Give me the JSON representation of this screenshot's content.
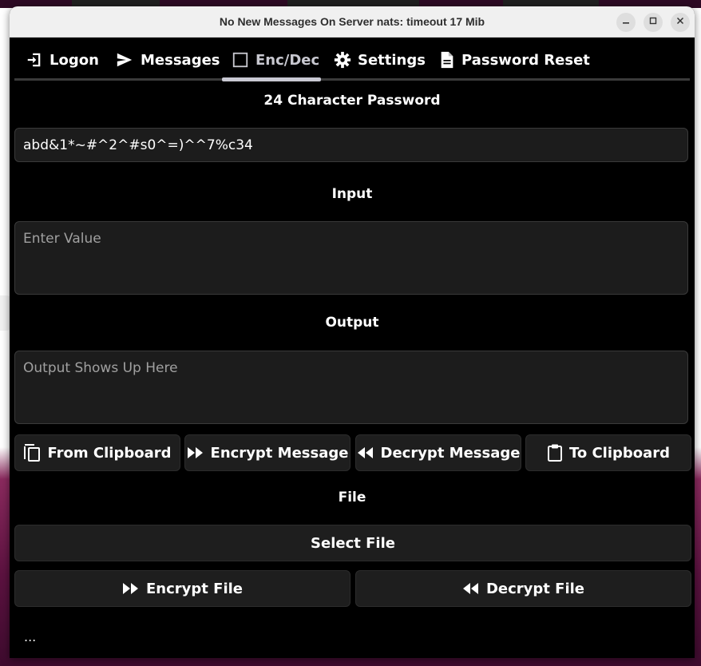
{
  "window": {
    "title": "No New Messages On Server nats: timeout 17 Mib"
  },
  "tabs": [
    {
      "label": "Logon",
      "icon": "login-icon"
    },
    {
      "label": "Messages",
      "icon": "send-icon"
    },
    {
      "label": "Enc/Dec",
      "icon": "checkbox-icon",
      "active": true
    },
    {
      "label": "Settings",
      "icon": "gear-icon"
    },
    {
      "label": "Password Reset",
      "icon": "document-icon"
    }
  ],
  "password": {
    "label": "24 Character Password",
    "value": "abd&1*~#^2^#s0^=)^^7%c34"
  },
  "input": {
    "label": "Input",
    "placeholder": "Enter Value"
  },
  "output": {
    "label": "Output",
    "placeholder": "Output Shows Up Here"
  },
  "actions": {
    "from_clipboard": "From Clipboard",
    "encrypt_message": "Encrypt Message",
    "decrypt_message": "Decrypt Message",
    "to_clipboard": "To Clipboard"
  },
  "file": {
    "label": "File",
    "select": "Select File",
    "encrypt": "Encrypt File",
    "decrypt": "Decrypt File"
  },
  "status": "...",
  "colors": {
    "background": "#000000",
    "button": "#1e1e1e",
    "field": "#1c1c1c",
    "active_tab": "#c9c9d3"
  }
}
